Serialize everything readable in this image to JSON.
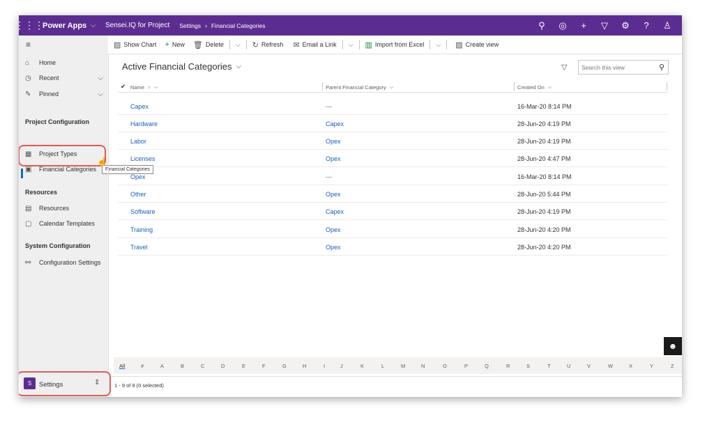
{
  "topbar": {
    "app_name": "Power Apps",
    "environment": "Sensei.IQ for Project",
    "breadcrumb": [
      "Settings",
      "Financial Categories"
    ],
    "icons": [
      "search-icon",
      "assistant-icon",
      "plus-icon",
      "filter-icon",
      "gear-icon",
      "help-icon",
      "person-icon"
    ]
  },
  "sidebar": {
    "nav": [
      {
        "label": "Home",
        "icon": "home-icon"
      },
      {
        "label": "Recent",
        "icon": "clock-icon"
      },
      {
        "label": "Pinned",
        "icon": "pin-icon"
      }
    ],
    "sections": [
      {
        "title": "Project Configuration",
        "items": [
          {
            "label": "Project Types",
            "icon": "grid-icon"
          },
          {
            "label": "Financial Categories",
            "icon": "money-icon",
            "selected": true
          }
        ]
      },
      {
        "title": "Resources",
        "items": [
          {
            "label": "Resources",
            "icon": "resource-icon"
          },
          {
            "label": "Calendar Templates",
            "icon": "calendar-icon"
          }
        ]
      },
      {
        "title": "System Configuration",
        "items": [
          {
            "label": "Configuration Settings",
            "icon": "config-icon"
          }
        ]
      }
    ],
    "tooltip": "Financial Categories",
    "area": {
      "badge": "S",
      "label": "Settings"
    }
  },
  "commands": {
    "show_chart": "Show Chart",
    "new": "New",
    "delete": "Delete",
    "refresh": "Refresh",
    "email_link": "Email a Link",
    "import_excel": "Import from Excel",
    "create_view": "Create view"
  },
  "view": {
    "title": "Active Financial Categories",
    "search_placeholder": "Search this view"
  },
  "grid": {
    "columns": [
      "Name",
      "Parent Financial Category",
      "Created On"
    ],
    "rows": [
      {
        "name": "Capex",
        "parent": "---",
        "created": "16-Mar-20 8:14 PM"
      },
      {
        "name": "Hardware",
        "parent": "Capex",
        "created": "28-Jun-20 4:19 PM"
      },
      {
        "name": "Labor",
        "parent": "Opex",
        "created": "28-Jun-20 4:19 PM"
      },
      {
        "name": "Licenses",
        "parent": "Opex",
        "created": "28-Jun-20 4:47 PM"
      },
      {
        "name": "Opex",
        "parent": "---",
        "created": "16-Mar-20 8:14 PM"
      },
      {
        "name": "Other",
        "parent": "Opex",
        "created": "28-Jun-20 5:44 PM"
      },
      {
        "name": "Software",
        "parent": "Capex",
        "created": "28-Jun-20 4:19 PM"
      },
      {
        "name": "Training",
        "parent": "Opex",
        "created": "28-Jun-20 4:20 PM"
      },
      {
        "name": "Travel",
        "parent": "Opex",
        "created": "28-Jun-20 4:20 PM"
      }
    ],
    "record_count": "1 - 9 of 9 (0 selected)"
  },
  "alphabet": [
    "All",
    "#",
    "A",
    "B",
    "C",
    "D",
    "E",
    "F",
    "G",
    "H",
    "I",
    "J",
    "K",
    "L",
    "M",
    "N",
    "O",
    "P",
    "Q",
    "R",
    "S",
    "T",
    "U",
    "V",
    "W",
    "X",
    "Y",
    "Z"
  ],
  "colors": {
    "brand": "#5c2d91",
    "link": "#1a5fb4",
    "highlight": "#e05a5a",
    "selected": "#0f6cbd"
  }
}
